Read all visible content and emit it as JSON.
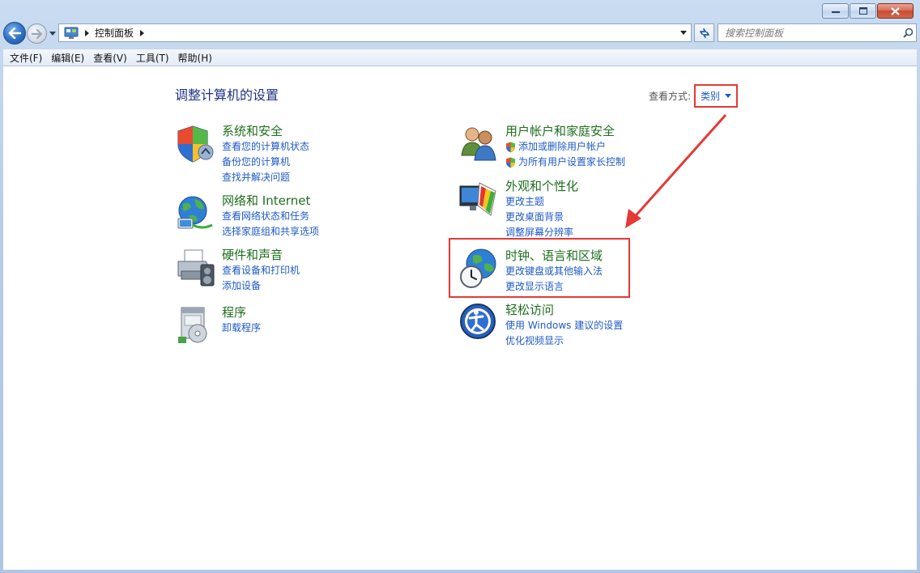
{
  "window": {
    "minimize_icon": "minimize-icon",
    "maximize_icon": "maximize-icon",
    "close_icon": "close-icon"
  },
  "address_bar": {
    "crumbs": [
      "控制面板"
    ],
    "search_placeholder": "搜索控制面板"
  },
  "menu": {
    "items": [
      "文件(F)",
      "编辑(E)",
      "查看(V)",
      "工具(T)",
      "帮助(H)"
    ]
  },
  "main": {
    "title": "调整计算机的设置",
    "view_by_label": "查看方式:",
    "view_by_value": "类别",
    "categories": [
      {
        "title": "系统和安全",
        "icon": "shield-icon",
        "links": [
          "查看您的计算机状态",
          "备份您的计算机",
          "查找并解决问题"
        ]
      },
      {
        "title": "网络和 Internet",
        "icon": "network-globe-icon",
        "links": [
          "查看网络状态和任务",
          "选择家庭组和共享选项"
        ]
      },
      {
        "title": "硬件和声音",
        "icon": "printer-icon",
        "links": [
          "查看设备和打印机",
          "添加设备"
        ]
      },
      {
        "title": "程序",
        "icon": "programs-icon",
        "links": [
          "卸载程序"
        ]
      },
      {
        "title": "用户帐户和家庭安全",
        "icon": "users-icon",
        "links": [
          "添加或删除用户帐户",
          "为所有用户设置家长控制"
        ]
      },
      {
        "title": "外观和个性化",
        "icon": "appearance-icon",
        "links": [
          "更改主题",
          "更改桌面背景",
          "调整屏幕分辨率"
        ]
      },
      {
        "title": "时钟、语言和区域",
        "icon": "clock-globe-icon",
        "links": [
          "更改键盘或其他输入法",
          "更改显示语言"
        ]
      },
      {
        "title": "轻松访问",
        "icon": "ease-of-access-icon",
        "links": [
          "使用 Windows 建议的设置",
          "优化视频显示"
        ]
      }
    ]
  },
  "colors": {
    "title_blue": "#1e3287",
    "category_green": "#1d6f1d",
    "link_blue": "#1e5bc6",
    "annotation_red": "#e53935"
  }
}
